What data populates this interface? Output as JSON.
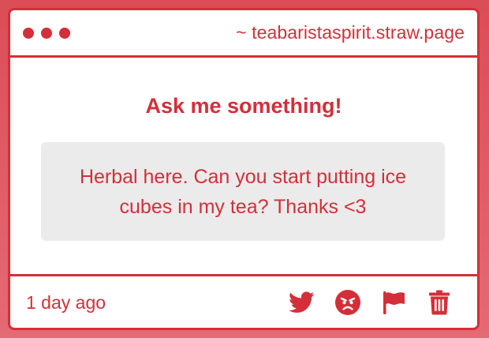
{
  "window": {
    "url": "~ teabaristaspirit.straw.page"
  },
  "main": {
    "heading": "Ask me something!",
    "message": "Herbal here. Can you start putting ice cubes in my tea? Thanks <3"
  },
  "footer": {
    "timestamp": "1 day ago",
    "actions": [
      {
        "icon": "twitter-icon"
      },
      {
        "icon": "angry-face-icon"
      },
      {
        "icon": "flag-icon"
      },
      {
        "icon": "trash-icon"
      }
    ]
  },
  "colors": {
    "accent": "#d42f39",
    "background": "#db4d57",
    "message_bg": "#ebebeb"
  }
}
